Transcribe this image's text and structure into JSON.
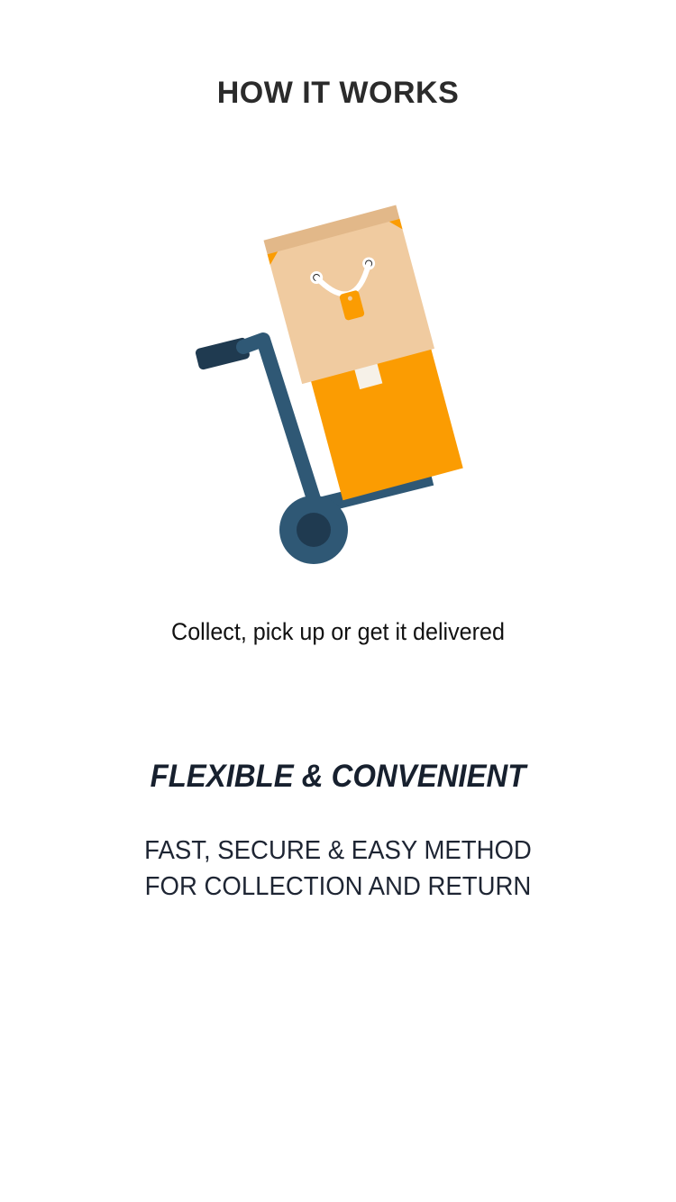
{
  "header": {
    "title": "HOW IT WORKS"
  },
  "illustration": {
    "icon": "delivery-trolley-with-boxes-icon",
    "colors": {
      "trolley": "#2f5875",
      "trolley_dark": "#1f3a50",
      "box_orange": "#fb9c02",
      "bag_beige": "#f0cba0",
      "bag_top": "#e2b889",
      "tag_orange": "#fb9c02"
    }
  },
  "tagline": "Collect, pick up or get it delivered",
  "feature": {
    "heading": "FLEXIBLE & CONVENIENT",
    "lines": [
      "FAST, SECURE & EASY METHOD",
      "FOR COLLECTION AND RETURN"
    ]
  }
}
